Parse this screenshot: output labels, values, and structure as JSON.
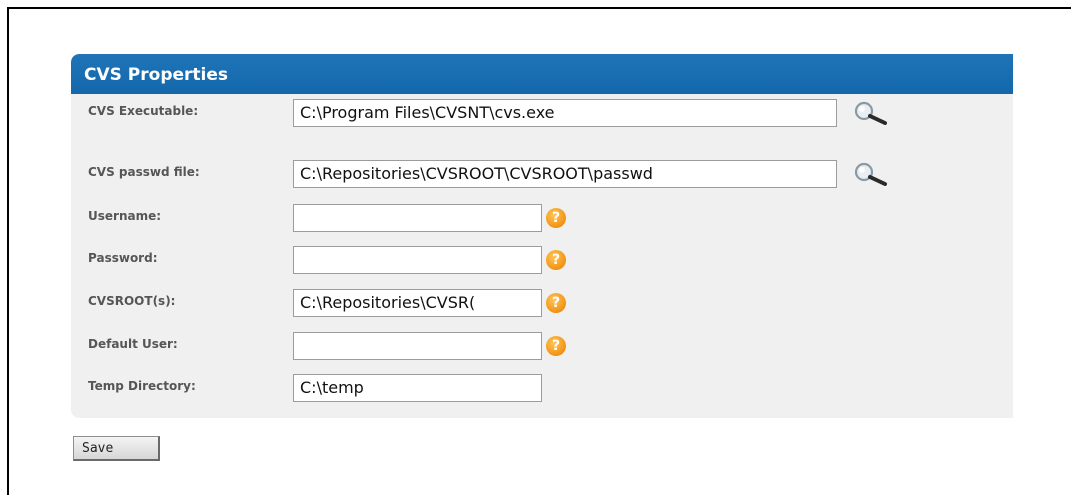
{
  "panel": {
    "title": "CVS Properties"
  },
  "fields": [
    {
      "label": "CVS Executable:",
      "value": "C:\\Program Files\\CVSNT\\cvs.exe",
      "icon": "search-icon"
    },
    {
      "label": "CVS passwd file:",
      "value": "C:\\Repositories\\CVSROOT\\CVSROOT\\passwd",
      "icon": "search-icon"
    },
    {
      "label": "Username:",
      "value": "",
      "icon": "help-icon"
    },
    {
      "label": "Password:",
      "value": "",
      "icon": "help-icon"
    },
    {
      "label": "CVSROOT(s):",
      "value": "C:\\Repositories\\CVSR(",
      "icon": "help-icon"
    },
    {
      "label": "Default User:",
      "value": "",
      "icon": "help-icon"
    },
    {
      "label": "Temp Directory:",
      "value": "C:\\temp",
      "icon": ""
    }
  ],
  "help_glyph": "?",
  "actions": {
    "save_label": "Save"
  },
  "colors": {
    "header": "#1a6db1",
    "panel_bg": "#f0f0f0",
    "help_icon": "#f39a1c"
  }
}
